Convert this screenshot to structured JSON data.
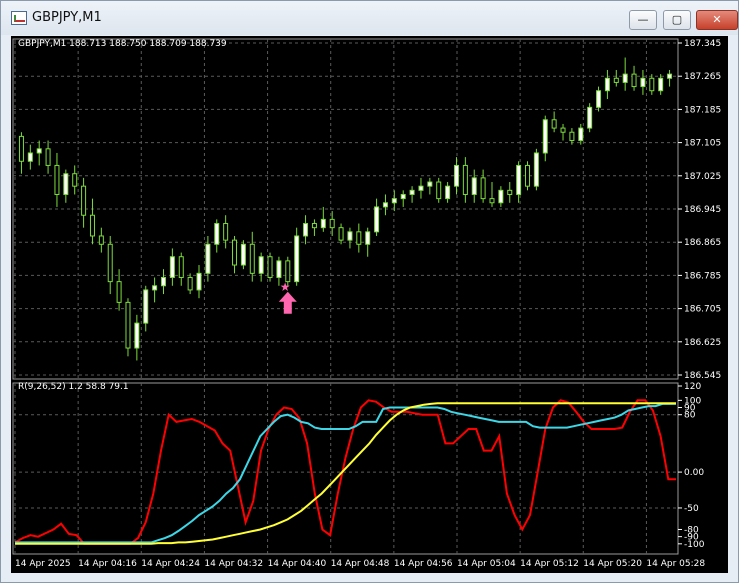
{
  "window": {
    "title": "GBPJPY,M1",
    "minimize_label": "—",
    "maximize_label": "▢",
    "close_label": "✕"
  },
  "ohlc_label": "GBPJPY,M1  188.713 188.750 188.709 188.739",
  "indicator_label": "R(9,26,52) 1.2 58.8 79.1",
  "colors": {
    "background": "#000000",
    "grid": "#5a5a5a",
    "bull_candle": "#ffffff",
    "bear_candle": "#000000",
    "wick": "#7cdc3c",
    "red_line": "#ff0000",
    "cyan_line": "#3cd8e8",
    "yellow_line": "#ffff33",
    "signal": "#ff66b0"
  },
  "chart_data": [
    {
      "type": "candlestick",
      "title": "",
      "price_axis_ticks": [
        "187.345",
        "187.265",
        "187.185",
        "187.105",
        "187.025",
        "186.945",
        "186.865",
        "186.785",
        "186.705",
        "186.625",
        "186.545"
      ],
      "ylim": [
        186.545,
        187.345
      ],
      "candles": [
        {
          "o": 187.12,
          "h": 187.13,
          "l": 187.03,
          "c": 187.06
        },
        {
          "o": 187.06,
          "h": 187.1,
          "l": 187.04,
          "c": 187.08
        },
        {
          "o": 187.08,
          "h": 187.11,
          "l": 187.05,
          "c": 187.09
        },
        {
          "o": 187.09,
          "h": 187.11,
          "l": 187.03,
          "c": 187.05
        },
        {
          "o": 187.05,
          "h": 187.08,
          "l": 186.95,
          "c": 186.98
        },
        {
          "o": 186.98,
          "h": 187.04,
          "l": 186.96,
          "c": 187.03
        },
        {
          "o": 187.03,
          "h": 187.05,
          "l": 186.98,
          "c": 187.0
        },
        {
          "o": 187.0,
          "h": 187.02,
          "l": 186.9,
          "c": 186.93
        },
        {
          "o": 186.93,
          "h": 186.97,
          "l": 186.86,
          "c": 186.88
        },
        {
          "o": 186.88,
          "h": 186.9,
          "l": 186.84,
          "c": 186.86
        },
        {
          "o": 186.86,
          "h": 186.88,
          "l": 186.74,
          "c": 186.77
        },
        {
          "o": 186.77,
          "h": 186.8,
          "l": 186.7,
          "c": 186.72
        },
        {
          "o": 186.72,
          "h": 186.73,
          "l": 186.59,
          "c": 186.61
        },
        {
          "o": 186.61,
          "h": 186.69,
          "l": 186.58,
          "c": 186.67
        },
        {
          "o": 186.67,
          "h": 186.76,
          "l": 186.65,
          "c": 186.75
        },
        {
          "o": 186.75,
          "h": 186.78,
          "l": 186.72,
          "c": 186.76
        },
        {
          "o": 186.76,
          "h": 186.8,
          "l": 186.74,
          "c": 186.78
        },
        {
          "o": 186.78,
          "h": 186.85,
          "l": 186.76,
          "c": 186.83
        },
        {
          "o": 186.83,
          "h": 186.84,
          "l": 186.76,
          "c": 186.78
        },
        {
          "o": 186.78,
          "h": 186.79,
          "l": 186.74,
          "c": 186.75
        },
        {
          "o": 186.75,
          "h": 186.81,
          "l": 186.73,
          "c": 186.79
        },
        {
          "o": 186.79,
          "h": 186.88,
          "l": 186.77,
          "c": 186.86
        },
        {
          "o": 186.86,
          "h": 186.92,
          "l": 186.84,
          "c": 186.91
        },
        {
          "o": 186.91,
          "h": 186.93,
          "l": 186.85,
          "c": 186.87
        },
        {
          "o": 186.87,
          "h": 186.88,
          "l": 186.79,
          "c": 186.81
        },
        {
          "o": 186.81,
          "h": 186.87,
          "l": 186.8,
          "c": 186.86
        },
        {
          "o": 186.86,
          "h": 186.89,
          "l": 186.77,
          "c": 186.79
        },
        {
          "o": 186.79,
          "h": 186.84,
          "l": 186.77,
          "c": 186.83
        },
        {
          "o": 186.83,
          "h": 186.84,
          "l": 186.77,
          "c": 186.78
        },
        {
          "o": 186.78,
          "h": 186.83,
          "l": 186.76,
          "c": 186.82
        },
        {
          "o": 186.82,
          "h": 186.83,
          "l": 186.76,
          "c": 186.77
        },
        {
          "o": 186.77,
          "h": 186.9,
          "l": 186.76,
          "c": 186.88
        },
        {
          "o": 186.88,
          "h": 186.93,
          "l": 186.86,
          "c": 186.91
        },
        {
          "o": 186.91,
          "h": 186.92,
          "l": 186.88,
          "c": 186.9
        },
        {
          "o": 186.9,
          "h": 186.95,
          "l": 186.89,
          "c": 186.92
        },
        {
          "o": 186.92,
          "h": 186.94,
          "l": 186.88,
          "c": 186.9
        },
        {
          "o": 186.9,
          "h": 186.91,
          "l": 186.86,
          "c": 186.87
        },
        {
          "o": 186.87,
          "h": 186.9,
          "l": 186.85,
          "c": 186.89
        },
        {
          "o": 186.89,
          "h": 186.91,
          "l": 186.84,
          "c": 186.86
        },
        {
          "o": 186.86,
          "h": 186.9,
          "l": 186.83,
          "c": 186.89
        },
        {
          "o": 186.89,
          "h": 186.97,
          "l": 186.88,
          "c": 186.95
        },
        {
          "o": 186.95,
          "h": 186.98,
          "l": 186.93,
          "c": 186.96
        },
        {
          "o": 186.96,
          "h": 186.99,
          "l": 186.94,
          "c": 186.97
        },
        {
          "o": 186.97,
          "h": 186.99,
          "l": 186.95,
          "c": 186.98
        },
        {
          "o": 186.98,
          "h": 187.0,
          "l": 186.96,
          "c": 186.99
        },
        {
          "o": 186.99,
          "h": 187.02,
          "l": 186.97,
          "c": 187.0
        },
        {
          "o": 187.0,
          "h": 187.02,
          "l": 186.98,
          "c": 187.01
        },
        {
          "o": 187.01,
          "h": 187.02,
          "l": 186.96,
          "c": 186.97
        },
        {
          "o": 186.97,
          "h": 187.01,
          "l": 186.96,
          "c": 187.0
        },
        {
          "o": 187.0,
          "h": 187.07,
          "l": 186.98,
          "c": 187.05
        },
        {
          "o": 187.05,
          "h": 187.07,
          "l": 186.96,
          "c": 186.98
        },
        {
          "o": 186.98,
          "h": 187.04,
          "l": 186.96,
          "c": 187.02
        },
        {
          "o": 187.02,
          "h": 187.04,
          "l": 186.96,
          "c": 186.97
        },
        {
          "o": 186.97,
          "h": 187.01,
          "l": 186.95,
          "c": 186.96
        },
        {
          "o": 186.96,
          "h": 187.0,
          "l": 186.95,
          "c": 186.99
        },
        {
          "o": 186.99,
          "h": 187.01,
          "l": 186.96,
          "c": 186.98
        },
        {
          "o": 186.98,
          "h": 187.06,
          "l": 186.96,
          "c": 187.05
        },
        {
          "o": 187.05,
          "h": 187.06,
          "l": 186.99,
          "c": 187.0
        },
        {
          "o": 187.0,
          "h": 187.09,
          "l": 186.99,
          "c": 187.08
        },
        {
          "o": 187.08,
          "h": 187.17,
          "l": 187.06,
          "c": 187.16
        },
        {
          "o": 187.16,
          "h": 187.18,
          "l": 187.13,
          "c": 187.14
        },
        {
          "o": 187.14,
          "h": 187.15,
          "l": 187.11,
          "c": 187.13
        },
        {
          "o": 187.13,
          "h": 187.14,
          "l": 187.1,
          "c": 187.11
        },
        {
          "o": 187.11,
          "h": 187.15,
          "l": 187.1,
          "c": 187.14
        },
        {
          "o": 187.14,
          "h": 187.2,
          "l": 187.13,
          "c": 187.19
        },
        {
          "o": 187.19,
          "h": 187.24,
          "l": 187.18,
          "c": 187.23
        },
        {
          "o": 187.23,
          "h": 187.28,
          "l": 187.21,
          "c": 187.26
        },
        {
          "o": 187.26,
          "h": 187.28,
          "l": 187.24,
          "c": 187.25
        },
        {
          "o": 187.25,
          "h": 187.31,
          "l": 187.23,
          "c": 187.27
        },
        {
          "o": 187.27,
          "h": 187.29,
          "l": 187.23,
          "c": 187.24
        },
        {
          "o": 187.24,
          "h": 187.28,
          "l": 187.22,
          "c": 187.26
        },
        {
          "o": 187.26,
          "h": 187.27,
          "l": 187.22,
          "c": 187.23
        },
        {
          "o": 187.23,
          "h": 187.27,
          "l": 187.22,
          "c": 187.26
        },
        {
          "o": 187.26,
          "h": 187.28,
          "l": 187.24,
          "c": 187.27
        }
      ],
      "signal_marker": {
        "candle_index": 30,
        "label": "↑"
      }
    },
    {
      "type": "line",
      "title": "",
      "ylim": [
        -110,
        120
      ],
      "y_axis_ticks": [
        "120",
        "100",
        "90",
        "80",
        "0.00",
        "-50",
        "-80",
        "-90",
        "-100"
      ],
      "y_axis_tick_values": [
        120,
        100,
        90,
        80,
        0,
        -50,
        -80,
        -90,
        -100
      ],
      "x_axis_ticks": [
        "14 Apr 2025",
        "14 Apr 04:16",
        "14 Apr 04:24",
        "14 Apr 04:32",
        "14 Apr 04:40",
        "14 Apr 04:48",
        "14 Apr 04:56",
        "14 Apr 05:04",
        "14 Apr 05:12",
        "14 Apr 05:20",
        "14 Apr 05:28"
      ],
      "series": [
        {
          "color": "#ff0000",
          "values": [
            -98,
            -92,
            -88,
            -90,
            -85,
            -80,
            -72,
            -86,
            -88,
            -100,
            -100,
            -100,
            -100,
            -100,
            -100,
            -100,
            -92,
            -70,
            -30,
            30,
            80,
            70,
            72,
            74,
            70,
            64,
            58,
            40,
            30,
            -20,
            -70,
            -40,
            30,
            60,
            80,
            90,
            88,
            75,
            40,
            -30,
            -80,
            -88,
            -30,
            20,
            60,
            90,
            100,
            98,
            90,
            84,
            84,
            84,
            82,
            80,
            80,
            80,
            40,
            40,
            50,
            60,
            60,
            30,
            30,
            50,
            -30,
            -60,
            -80,
            -60,
            0,
            60,
            90,
            100,
            97,
            84,
            70,
            60,
            60,
            60,
            60,
            62,
            84,
            100,
            100,
            86,
            50,
            -10,
            -10
          ]
        },
        {
          "color": "#3cd8e8",
          "values": [
            -98,
            -98,
            -98,
            -98,
            -98,
            -98,
            -98,
            -98,
            -98,
            -98,
            -98,
            -98,
            -98,
            -98,
            -98,
            -98,
            -98,
            -98,
            -98,
            -98,
            -98,
            -95,
            -92,
            -88,
            -82,
            -75,
            -68,
            -60,
            -54,
            -48,
            -40,
            -30,
            -22,
            -10,
            10,
            30,
            50,
            60,
            70,
            78,
            80,
            76,
            70,
            68,
            62,
            60,
            60,
            60,
            60,
            60,
            64,
            70,
            70,
            70,
            88,
            90,
            90,
            90,
            90,
            90,
            90,
            90,
            90,
            88,
            84,
            82,
            80,
            78,
            76,
            74,
            72,
            70,
            70,
            70,
            70,
            70,
            64,
            62,
            62,
            62,
            62,
            62,
            64,
            66,
            68,
            70,
            72,
            74,
            76,
            80,
            86,
            88,
            90,
            92,
            92,
            95,
            95,
            95
          ]
        },
        {
          "color": "#ffff33",
          "values": [
            -100,
            -100,
            -100,
            -100,
            -100,
            -100,
            -100,
            -100,
            -100,
            -100,
            -100,
            -100,
            -100,
            -100,
            -100,
            -100,
            -100,
            -100,
            -100,
            -100,
            -100,
            -99,
            -99,
            -99,
            -98,
            -98,
            -97,
            -96,
            -95,
            -94,
            -92,
            -90,
            -88,
            -86,
            -84,
            -82,
            -80,
            -77,
            -74,
            -70,
            -66,
            -60,
            -54,
            -46,
            -38,
            -30,
            -20,
            -10,
            0,
            10,
            20,
            30,
            40,
            52,
            62,
            72,
            80,
            86,
            90,
            92,
            94,
            95,
            96,
            96,
            96,
            96,
            96,
            96,
            96,
            96,
            96,
            96,
            96,
            96,
            96,
            96,
            96,
            96,
            96,
            96,
            96,
            96,
            96,
            96,
            96,
            96,
            96,
            96,
            96,
            96,
            96,
            96,
            96,
            96,
            96,
            96,
            96,
            96
          ]
        }
      ]
    }
  ]
}
